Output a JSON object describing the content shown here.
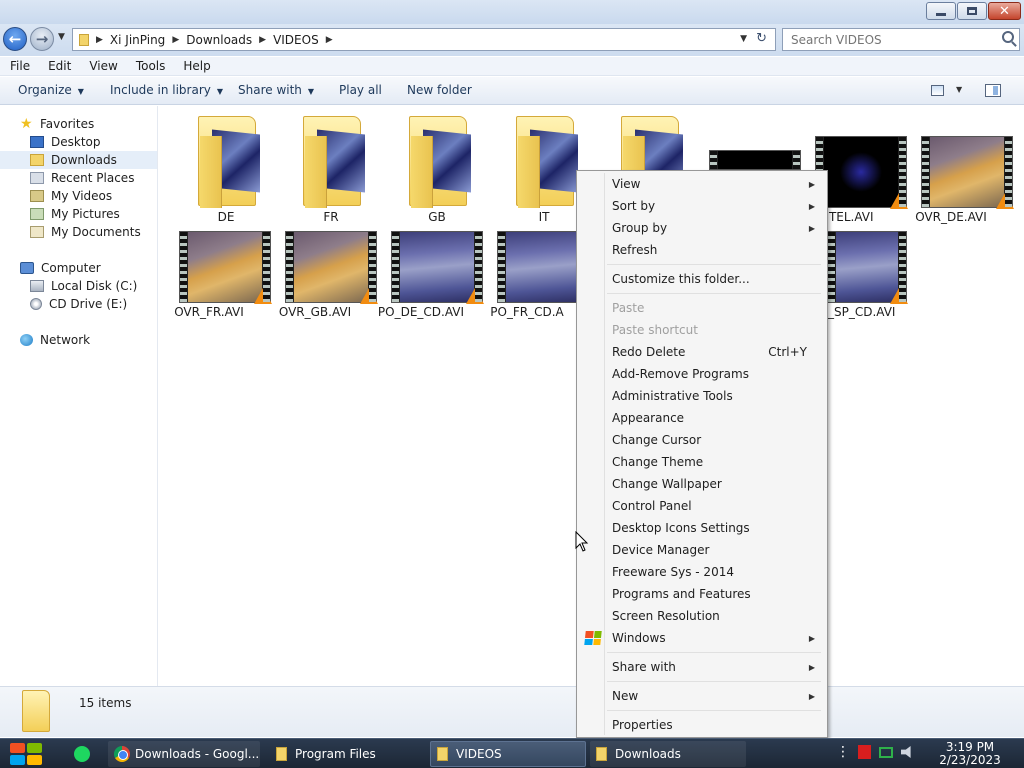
{
  "window": {
    "minimize_glyph": "—",
    "maximize_glyph": "□",
    "close_glyph": "✕"
  },
  "breadcrumb": [
    "Xi JinPing",
    "Downloads",
    "VIDEOS"
  ],
  "search": {
    "placeholder": "Search VIDEOS"
  },
  "menubar": [
    "File",
    "Edit",
    "View",
    "Tools",
    "Help"
  ],
  "toolbar": {
    "organize": "Organize",
    "include_in_library": "Include in library",
    "share_with": "Share with",
    "play_all": "Play all",
    "new_folder": "New folder"
  },
  "navigation": {
    "favorites": "Favorites",
    "desktop": "Desktop",
    "downloads": "Downloads",
    "recent_places": "Recent Places",
    "my_videos": "My Videos",
    "my_pictures": "My Pictures",
    "my_documents": "My Documents",
    "computer": "Computer",
    "local_disk": "Local Disk (C:)",
    "cd_drive": "CD Drive (E:)",
    "network": "Network"
  },
  "files": [
    {
      "name": "DE",
      "kind": "folder"
    },
    {
      "name": "FR",
      "kind": "folder"
    },
    {
      "name": "GB",
      "kind": "folder"
    },
    {
      "name": "IT",
      "kind": "folder"
    },
    {
      "name": "",
      "kind": "folder"
    },
    {
      "name": "",
      "kind": "video"
    },
    {
      "name": "INTEL.AVI",
      "kind": "video"
    },
    {
      "name": "OVR_DE.AVI",
      "kind": "video"
    },
    {
      "name": "OVR_FR.AVI",
      "kind": "video"
    },
    {
      "name": "OVR_GB.AVI",
      "kind": "video"
    },
    {
      "name": "PO_DE_CD.AVI",
      "kind": "video"
    },
    {
      "name": "PO_FR_CD.A",
      "kind": "video"
    },
    {
      "name": "O_SP_CD.AVI",
      "kind": "video"
    }
  ],
  "status": {
    "item_count": "15 items"
  },
  "context_menu": {
    "view": "View",
    "sort_by": "Sort by",
    "group_by": "Group by",
    "refresh": "Refresh",
    "customize": "Customize this folder...",
    "paste": "Paste",
    "paste_shortcut": "Paste shortcut",
    "redo_delete": "Redo Delete",
    "redo_shortcut": "Ctrl+Y",
    "add_remove": "Add-Remove Programs",
    "admin_tools": "Administrative Tools",
    "appearance": "Appearance",
    "change_cursor": "Change Cursor",
    "change_theme": "Change Theme",
    "change_wallpaper": "Change Wallpaper",
    "control_panel": "Control Panel",
    "desktop_icons": "Desktop Icons Settings",
    "device_manager": "Device Manager",
    "freeware_sys": "Freeware Sys - 2014",
    "programs_features": "Programs and Features",
    "screen_resolution": "Screen Resolution",
    "windows": "Windows",
    "share_with": "Share with",
    "new": "New",
    "properties": "Properties"
  },
  "taskbar": {
    "chrome": "Downloads - Googl...",
    "program_files": "Program Files",
    "videos": "VIDEOS",
    "downloads": "Downloads",
    "tray_dots": "⋮",
    "time": "3:19 PM",
    "date": "2/23/2023"
  }
}
